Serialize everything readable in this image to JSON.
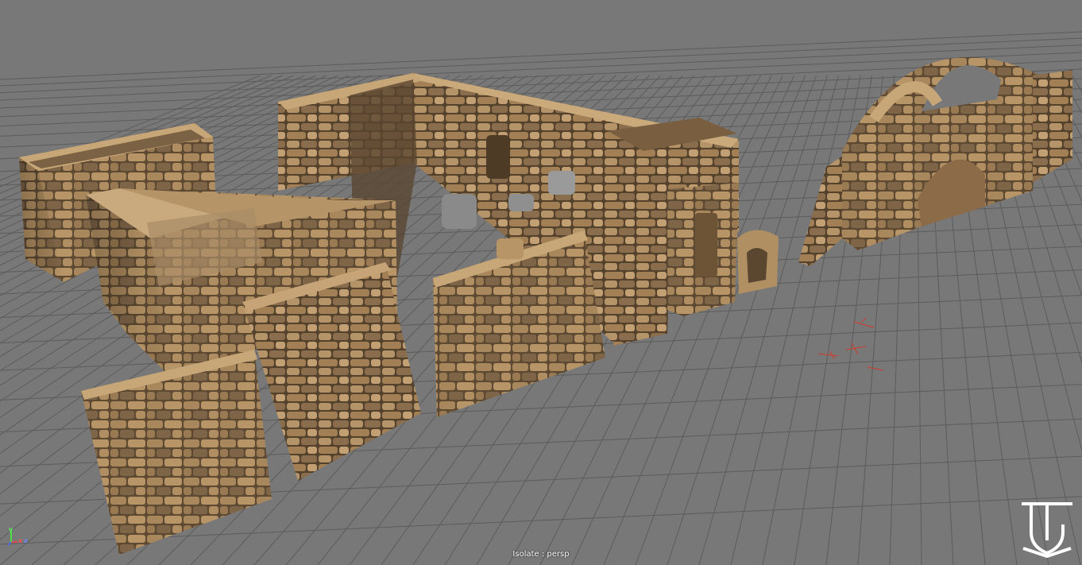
{
  "viewport": {
    "camera": "persp",
    "label": "Isolate : persp",
    "background": "#787878",
    "grid_color": "#5a5a5a"
  },
  "axis_gizmo": {
    "x": "x",
    "y": "y",
    "z": "z"
  },
  "logo": {
    "icon": "jg-monogram-logo",
    "color": "#ffffff"
  },
  "scene_objects": [
    "stone-wall-box-left",
    "stone-wall-l-shaped-corner",
    "stone-wall-straight-panel",
    "stone-wall-slanted-panel",
    "stone-building-back-with-windows",
    "stone-wall-short-panel",
    "stone-window-frame",
    "stone-small-arch",
    "stone-arch-ruin",
    "locator-manipulator"
  ],
  "colors": {
    "stone": "#a8875c",
    "stone_dark": "#7d6040",
    "stone_light": "#c7a678",
    "mortar": "#5e4a32"
  }
}
